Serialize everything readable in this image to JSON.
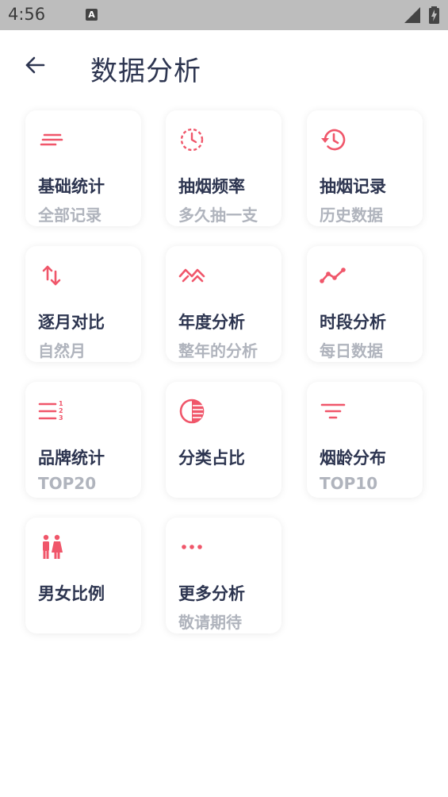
{
  "status": {
    "time": "4:56",
    "badge": "A"
  },
  "header": {
    "title": "数据分析"
  },
  "colors": {
    "accent": "#f0566a",
    "title": "#2d3550",
    "sub": "#b0b4bd"
  },
  "cards": [
    {
      "label": "基础统计",
      "sub": "全部记录",
      "icon": "lines-icon"
    },
    {
      "label": "抽烟频率",
      "sub": "多久抽一支",
      "icon": "clock-dashed-icon"
    },
    {
      "label": "抽烟记录",
      "sub": "历史数据",
      "icon": "history-icon"
    },
    {
      "label": "逐月对比",
      "sub": "自然月",
      "icon": "sort-arrows-icon"
    },
    {
      "label": "年度分析",
      "sub": "整年的分析",
      "icon": "zigzag-icon"
    },
    {
      "label": "时段分析",
      "sub": "每日数据",
      "icon": "trend-line-icon"
    },
    {
      "label": "品牌统计",
      "sub": "TOP20",
      "icon": "numbered-list-icon"
    },
    {
      "label": "分类占比",
      "sub": "",
      "icon": "contrast-circle-icon"
    },
    {
      "label": "烟龄分布",
      "sub": "TOP10",
      "icon": "filter-icon"
    },
    {
      "label": "男女比例",
      "sub": "",
      "icon": "man-woman-icon"
    },
    {
      "label": "更多分析",
      "sub": "敬请期待",
      "icon": "more-dots-icon"
    }
  ]
}
